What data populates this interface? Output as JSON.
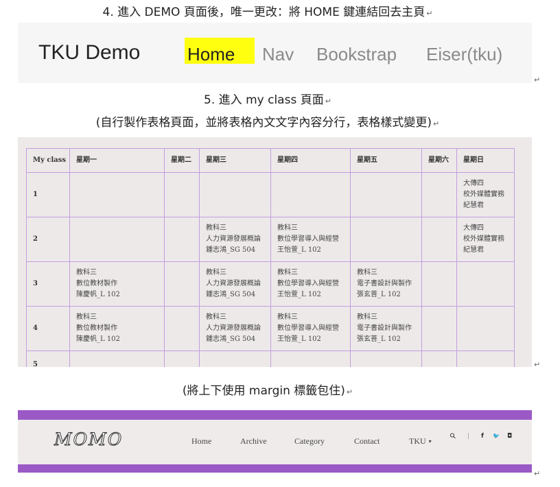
{
  "doc": {
    "step4": "4.  進入 DEMO 頁面後，唯一更改：將 HOME 鍵連結回去主頁",
    "step5_title": "5.  進入 my class 頁面",
    "step5_desc": "(自行製作表格頁面，並將表格內文文字內容分行，表格樣式變更)",
    "margin_note": "(將上下使用 margin 標籤包住)",
    "return_mark": "↵"
  },
  "nav1": {
    "brand": "TKU Demo",
    "links": [
      "Home",
      "Nav",
      "Bookstrap",
      "Eiser(tku)"
    ],
    "highlight_color": "#ffff10"
  },
  "schedule": {
    "headers": [
      "My class",
      "星期一",
      "星期二",
      "星期三",
      "星期四",
      "星期五",
      "星期六",
      "星期日"
    ],
    "rows": [
      {
        "label": "1",
        "cells": [
          [],
          [],
          [],
          [],
          [],
          [],
          [
            "大傳四",
            "校外媒體實務",
            "紀慧君"
          ]
        ]
      },
      {
        "label": "2",
        "cells": [
          [],
          [],
          [
            "教科三",
            "人力資源發展概論",
            "鍾志鴻_SG 504"
          ],
          [
            "教科三",
            "數位學習導入與經營",
            "王怡萱_L 102"
          ],
          [],
          [],
          [
            "大傳四",
            "校外媒體實務",
            "紀慧君"
          ]
        ]
      },
      {
        "label": "3",
        "cells": [
          [
            "教科三",
            "數位教材製作",
            "陳慶帆_L 102"
          ],
          [],
          [
            "教科三",
            "人力資源發展概論",
            "鍾志鴻_SG 504"
          ],
          [
            "教科三",
            "數位學習導入與經營",
            "王怡萱_L 102"
          ],
          [
            "教科三",
            "電子書設計與製作",
            "張玄菩_L 102"
          ],
          [],
          []
        ]
      },
      {
        "label": "4",
        "cells": [
          [
            "教科三",
            "數位教材製作",
            "陳慶帆_L 102"
          ],
          [],
          [
            "教科三",
            "人力資源發展概論",
            "鍾志鴻_SG 504"
          ],
          [
            "教科三",
            "數位學習導入與經營",
            "王怡萱_L 102"
          ],
          [
            "教科三",
            "電子書設計與製作",
            "張玄菩_L 102"
          ],
          [],
          []
        ]
      },
      {
        "label": "5",
        "cells": [
          [],
          [],
          [],
          [],
          [],
          [],
          []
        ]
      }
    ],
    "border_color": "#c39de0"
  },
  "nav3": {
    "logo": "MOMO",
    "links": [
      "Home",
      "Archive",
      "Category",
      "Contact",
      "TKU"
    ],
    "dropdown_caret": "▾",
    "icons": {
      "search": "⚲",
      "divider": "|",
      "facebook": "f",
      "twitter": "🐦",
      "instagram": "◘"
    },
    "bar_color": "#9b59c6"
  }
}
